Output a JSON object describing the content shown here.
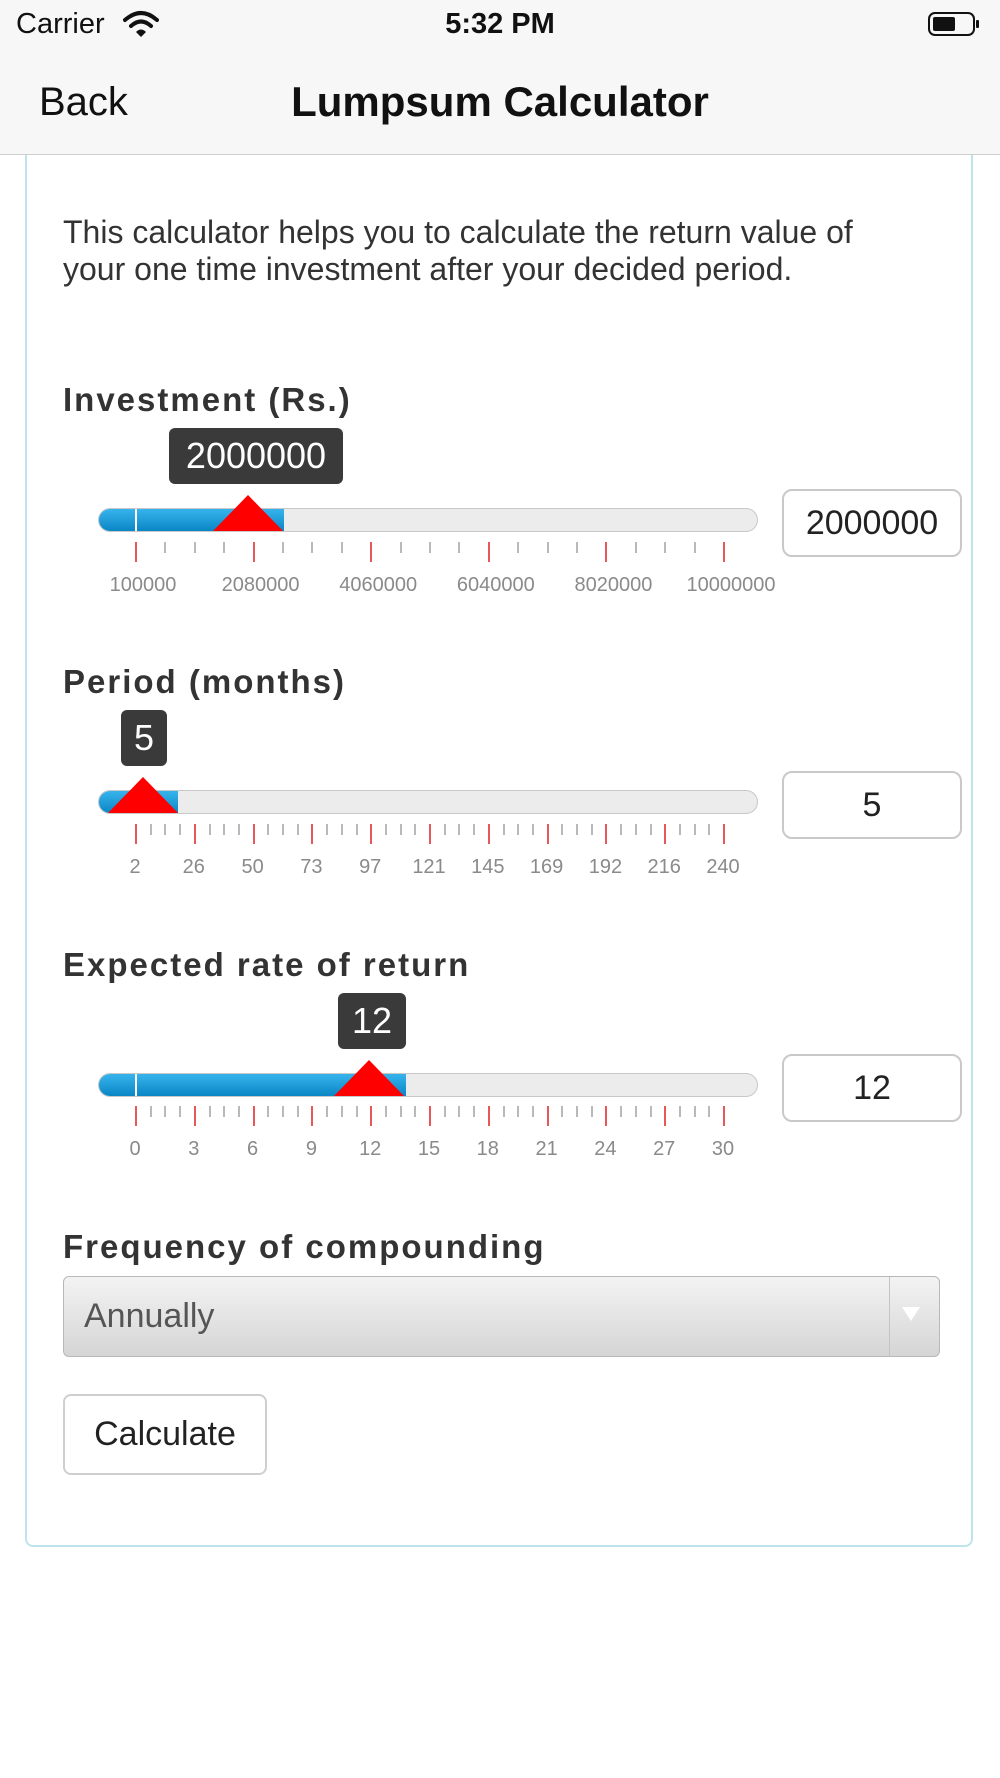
{
  "status_bar": {
    "carrier": "Carrier",
    "time": "5:32 PM"
  },
  "nav": {
    "back_label": "Back",
    "title": "Lumpsum Calculator"
  },
  "intro": "This calculator helps you to calculate the return value of your one time investment after your decided period.",
  "sliders": [
    {
      "label": "Investment (Rs.)",
      "value": 2000000,
      "value_text": "2000000",
      "min": 100000,
      "max": 10000000,
      "tick_labels": [
        "100000",
        "2080000",
        "4060000",
        "6040000",
        "8020000",
        "10000000"
      ]
    },
    {
      "label": "Period (months)",
      "value": 5,
      "value_text": "5",
      "min": 2,
      "max": 240,
      "tick_labels": [
        "2",
        "26",
        "50",
        "73",
        "97",
        "121",
        "145",
        "169",
        "192",
        "216",
        "240"
      ]
    },
    {
      "label": "Expected rate of return",
      "value": 12,
      "value_text": "12",
      "min": 0,
      "max": 30,
      "tick_labels": [
        "0",
        "3",
        "6",
        "9",
        "12",
        "15",
        "18",
        "21",
        "24",
        "27",
        "30"
      ]
    }
  ],
  "frequency": {
    "label": "Frequency of compounding",
    "selected": "Annually"
  },
  "calculate_label": "Calculate",
  "colors": {
    "accent_fill": "#0a86c6",
    "thumb": "#ff0000",
    "major_tick": "#e8585a"
  }
}
